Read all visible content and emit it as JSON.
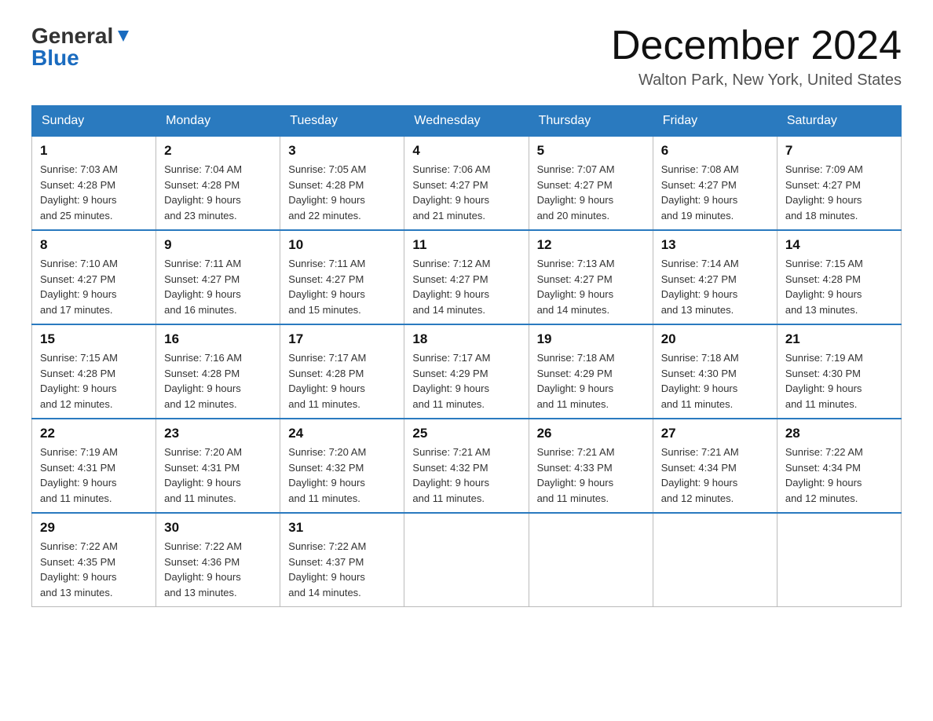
{
  "logo": {
    "general": "General",
    "blue": "Blue"
  },
  "title": "December 2024",
  "location": "Walton Park, New York, United States",
  "days_of_week": [
    "Sunday",
    "Monday",
    "Tuesday",
    "Wednesday",
    "Thursday",
    "Friday",
    "Saturday"
  ],
  "weeks": [
    [
      {
        "day": "1",
        "info": "Sunrise: 7:03 AM\nSunset: 4:28 PM\nDaylight: 9 hours\nand 25 minutes."
      },
      {
        "day": "2",
        "info": "Sunrise: 7:04 AM\nSunset: 4:28 PM\nDaylight: 9 hours\nand 23 minutes."
      },
      {
        "day": "3",
        "info": "Sunrise: 7:05 AM\nSunset: 4:28 PM\nDaylight: 9 hours\nand 22 minutes."
      },
      {
        "day": "4",
        "info": "Sunrise: 7:06 AM\nSunset: 4:27 PM\nDaylight: 9 hours\nand 21 minutes."
      },
      {
        "day": "5",
        "info": "Sunrise: 7:07 AM\nSunset: 4:27 PM\nDaylight: 9 hours\nand 20 minutes."
      },
      {
        "day": "6",
        "info": "Sunrise: 7:08 AM\nSunset: 4:27 PM\nDaylight: 9 hours\nand 19 minutes."
      },
      {
        "day": "7",
        "info": "Sunrise: 7:09 AM\nSunset: 4:27 PM\nDaylight: 9 hours\nand 18 minutes."
      }
    ],
    [
      {
        "day": "8",
        "info": "Sunrise: 7:10 AM\nSunset: 4:27 PM\nDaylight: 9 hours\nand 17 minutes."
      },
      {
        "day": "9",
        "info": "Sunrise: 7:11 AM\nSunset: 4:27 PM\nDaylight: 9 hours\nand 16 minutes."
      },
      {
        "day": "10",
        "info": "Sunrise: 7:11 AM\nSunset: 4:27 PM\nDaylight: 9 hours\nand 15 minutes."
      },
      {
        "day": "11",
        "info": "Sunrise: 7:12 AM\nSunset: 4:27 PM\nDaylight: 9 hours\nand 14 minutes."
      },
      {
        "day": "12",
        "info": "Sunrise: 7:13 AM\nSunset: 4:27 PM\nDaylight: 9 hours\nand 14 minutes."
      },
      {
        "day": "13",
        "info": "Sunrise: 7:14 AM\nSunset: 4:27 PM\nDaylight: 9 hours\nand 13 minutes."
      },
      {
        "day": "14",
        "info": "Sunrise: 7:15 AM\nSunset: 4:28 PM\nDaylight: 9 hours\nand 13 minutes."
      }
    ],
    [
      {
        "day": "15",
        "info": "Sunrise: 7:15 AM\nSunset: 4:28 PM\nDaylight: 9 hours\nand 12 minutes."
      },
      {
        "day": "16",
        "info": "Sunrise: 7:16 AM\nSunset: 4:28 PM\nDaylight: 9 hours\nand 12 minutes."
      },
      {
        "day": "17",
        "info": "Sunrise: 7:17 AM\nSunset: 4:28 PM\nDaylight: 9 hours\nand 11 minutes."
      },
      {
        "day": "18",
        "info": "Sunrise: 7:17 AM\nSunset: 4:29 PM\nDaylight: 9 hours\nand 11 minutes."
      },
      {
        "day": "19",
        "info": "Sunrise: 7:18 AM\nSunset: 4:29 PM\nDaylight: 9 hours\nand 11 minutes."
      },
      {
        "day": "20",
        "info": "Sunrise: 7:18 AM\nSunset: 4:30 PM\nDaylight: 9 hours\nand 11 minutes."
      },
      {
        "day": "21",
        "info": "Sunrise: 7:19 AM\nSunset: 4:30 PM\nDaylight: 9 hours\nand 11 minutes."
      }
    ],
    [
      {
        "day": "22",
        "info": "Sunrise: 7:19 AM\nSunset: 4:31 PM\nDaylight: 9 hours\nand 11 minutes."
      },
      {
        "day": "23",
        "info": "Sunrise: 7:20 AM\nSunset: 4:31 PM\nDaylight: 9 hours\nand 11 minutes."
      },
      {
        "day": "24",
        "info": "Sunrise: 7:20 AM\nSunset: 4:32 PM\nDaylight: 9 hours\nand 11 minutes."
      },
      {
        "day": "25",
        "info": "Sunrise: 7:21 AM\nSunset: 4:32 PM\nDaylight: 9 hours\nand 11 minutes."
      },
      {
        "day": "26",
        "info": "Sunrise: 7:21 AM\nSunset: 4:33 PM\nDaylight: 9 hours\nand 11 minutes."
      },
      {
        "day": "27",
        "info": "Sunrise: 7:21 AM\nSunset: 4:34 PM\nDaylight: 9 hours\nand 12 minutes."
      },
      {
        "day": "28",
        "info": "Sunrise: 7:22 AM\nSunset: 4:34 PM\nDaylight: 9 hours\nand 12 minutes."
      }
    ],
    [
      {
        "day": "29",
        "info": "Sunrise: 7:22 AM\nSunset: 4:35 PM\nDaylight: 9 hours\nand 13 minutes."
      },
      {
        "day": "30",
        "info": "Sunrise: 7:22 AM\nSunset: 4:36 PM\nDaylight: 9 hours\nand 13 minutes."
      },
      {
        "day": "31",
        "info": "Sunrise: 7:22 AM\nSunset: 4:37 PM\nDaylight: 9 hours\nand 14 minutes."
      },
      {
        "day": "",
        "info": ""
      },
      {
        "day": "",
        "info": ""
      },
      {
        "day": "",
        "info": ""
      },
      {
        "day": "",
        "info": ""
      }
    ]
  ]
}
